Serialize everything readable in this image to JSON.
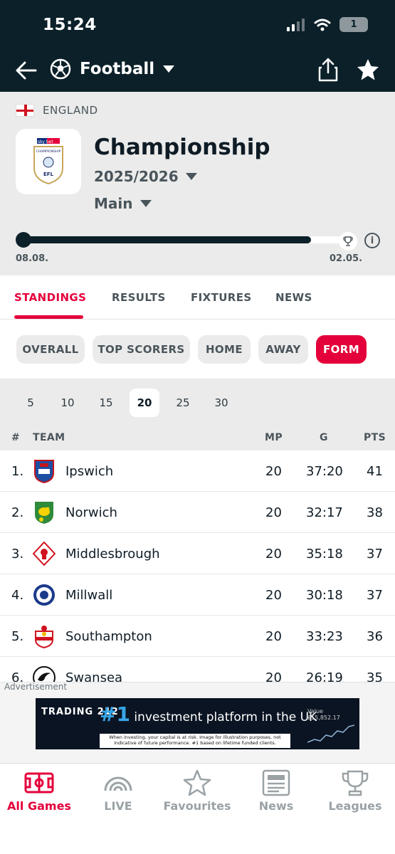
{
  "status": {
    "time": "15:24",
    "battery": "1"
  },
  "nav": {
    "sport_label": "Football"
  },
  "header": {
    "country": "ENGLAND",
    "league_name": "Championship",
    "season": "2025/2026",
    "stage": "Main",
    "progress_fraction": 0.9,
    "date_start": "08.08.",
    "date_end": "02.05.",
    "info_glyph": "i",
    "logo_sponsor": "sky bet",
    "logo_text": "CHAMPIONSHIP",
    "logo_efl": "EFL"
  },
  "tabs": [
    {
      "label": "STANDINGS",
      "active": true
    },
    {
      "label": "RESULTS"
    },
    {
      "label": "FIXTURES"
    },
    {
      "label": "NEWS"
    }
  ],
  "filters": [
    {
      "label": "OVERALL"
    },
    {
      "label": "TOP SCORERS"
    },
    {
      "label": "HOME"
    },
    {
      "label": "AWAY"
    },
    {
      "label": "FORM",
      "active": true
    }
  ],
  "form_options": [
    {
      "label": "5"
    },
    {
      "label": "10"
    },
    {
      "label": "15"
    },
    {
      "label": "20",
      "active": true
    },
    {
      "label": "25"
    },
    {
      "label": "30"
    }
  ],
  "table": {
    "headers": {
      "rank": "#",
      "team": "TEAM",
      "mp": "MP",
      "goals": "G",
      "pts": "PTS"
    },
    "rows": [
      {
        "rank": "1.",
        "team": "Ipswich",
        "mp": "20",
        "goals": "37:20",
        "pts": "41",
        "crest": "ipswich-crest-icon"
      },
      {
        "rank": "2.",
        "team": "Norwich",
        "mp": "20",
        "goals": "32:17",
        "pts": "38",
        "crest": "norwich-crest-icon"
      },
      {
        "rank": "3.",
        "team": "Middlesbrough",
        "mp": "20",
        "goals": "35:18",
        "pts": "37",
        "crest": "middlesbrough-crest-icon"
      },
      {
        "rank": "4.",
        "team": "Millwall",
        "mp": "20",
        "goals": "30:18",
        "pts": "37",
        "crest": "millwall-crest-icon"
      },
      {
        "rank": "5.",
        "team": "Southampton",
        "mp": "20",
        "goals": "33:23",
        "pts": "36",
        "crest": "southampton-crest-icon"
      },
      {
        "rank": "6.",
        "team": "Swansea",
        "mp": "20",
        "goals": "26:19",
        "pts": "35",
        "crest": "swansea-crest-icon"
      }
    ]
  },
  "ad": {
    "label": "Advertisement",
    "brand": "TRADING 212",
    "headline_rank": "#1",
    "headline_text": "investment platform in the UK",
    "disclaimer": "When investing, your capital is at risk. Image for illustration purposes, not indicative of future performance. #1 based on lifetime funded clients.",
    "value_label": "Value",
    "value_amount": "£15,852.17"
  },
  "bottom_nav": [
    {
      "label": "All Games",
      "icon": "pitch-icon",
      "active": true
    },
    {
      "label": "LIVE",
      "icon": "live-icon"
    },
    {
      "label": "Favourites",
      "icon": "star-outline-icon"
    },
    {
      "label": "News",
      "icon": "newspaper-icon"
    },
    {
      "label": "Leagues",
      "icon": "trophy-icon"
    }
  ],
  "colors": {
    "accent": "#e4003a",
    "dark": "#0b2029",
    "panel": "#ebebeb",
    "muted": "#4a555b"
  }
}
